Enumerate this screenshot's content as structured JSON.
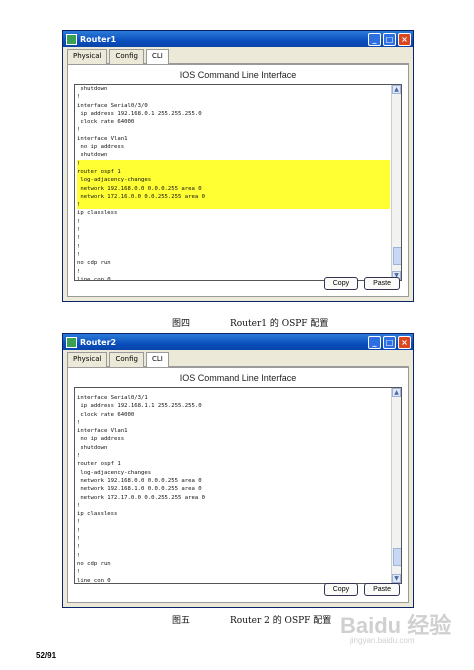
{
  "window1": {
    "title": "Router1",
    "tabs": [
      "Physical",
      "Config",
      "CLI"
    ],
    "active_tab": "CLI",
    "heading": "IOS Command Line Interface",
    "lines": [
      {
        "text": " shutdown",
        "hl": false
      },
      {
        "text": "!",
        "hl": false
      },
      {
        "text": "interface Serial0/3/0",
        "hl": false
      },
      {
        "text": " ip address 192.168.0.1 255.255.255.0",
        "hl": false
      },
      {
        "text": " clock rate 64000",
        "hl": false
      },
      {
        "text": "!",
        "hl": false
      },
      {
        "text": "interface Vlan1",
        "hl": false
      },
      {
        "text": " no ip address",
        "hl": false
      },
      {
        "text": " shutdown",
        "hl": false
      },
      {
        "text": "!",
        "hl": true
      },
      {
        "text": "router ospf 1",
        "hl": true
      },
      {
        "text": " log-adjacency-changes",
        "hl": true
      },
      {
        "text": " network 192.168.0.0 0.0.0.255 area 0",
        "hl": true
      },
      {
        "text": " network 172.16.0.0 0.0.255.255 area 0",
        "hl": true
      },
      {
        "text": "!",
        "hl": true
      },
      {
        "text": "ip classless",
        "hl": false
      },
      {
        "text": "!",
        "hl": false
      },
      {
        "text": "!",
        "hl": false
      },
      {
        "text": "!",
        "hl": false
      },
      {
        "text": "!",
        "hl": false
      },
      {
        "text": "!",
        "hl": false
      },
      {
        "text": "no cdp run",
        "hl": false
      },
      {
        "text": "!",
        "hl": false
      },
      {
        "text": "line con 0",
        "hl": false
      }
    ],
    "copy_label": "Copy",
    "paste_label": "Paste"
  },
  "caption1": {
    "label": "图四",
    "text": "Router1 的 OSPF 配置"
  },
  "window2": {
    "title": "Router2",
    "tabs": [
      "Physical",
      "Config",
      "CLI"
    ],
    "active_tab": "CLI",
    "heading": "IOS Command Line Interface",
    "lines": [
      {
        "text": "interface Serial0/3/1",
        "hl": false
      },
      {
        "text": " ip address 192.168.1.1 255.255.255.0",
        "hl": false
      },
      {
        "text": " clock rate 64000",
        "hl": false
      },
      {
        "text": "!",
        "hl": false
      },
      {
        "text": "interface Vlan1",
        "hl": false
      },
      {
        "text": " no ip address",
        "hl": false
      },
      {
        "text": " shutdown",
        "hl": false
      },
      {
        "text": "!",
        "hl": false
      },
      {
        "text": "router ospf 1",
        "hl": false
      },
      {
        "text": " log-adjacency-changes",
        "hl": false
      },
      {
        "text": " network 192.168.0.0 0.0.0.255 area 0",
        "hl": false
      },
      {
        "text": " network 192.168.1.0 0.0.0.255 area 0",
        "hl": false
      },
      {
        "text": " network 172.17.0.0 0.0.255.255 area 0",
        "hl": false
      },
      {
        "text": "!",
        "hl": false
      },
      {
        "text": "ip classless",
        "hl": false
      },
      {
        "text": "!",
        "hl": false
      },
      {
        "text": "!",
        "hl": false
      },
      {
        "text": "!",
        "hl": false
      },
      {
        "text": "!",
        "hl": false
      },
      {
        "text": "!",
        "hl": false
      },
      {
        "text": "no cdp run",
        "hl": false
      },
      {
        "text": "!",
        "hl": false
      },
      {
        "text": "line con 0",
        "hl": false
      }
    ],
    "copy_label": "Copy",
    "paste_label": "Paste"
  },
  "caption2": {
    "label": "图五",
    "text": "Router 2 的 OSPF 配置"
  },
  "page_number": "52/91",
  "watermark": {
    "text": "Baidu 经验",
    "sub": "jingyan.baidu.com"
  }
}
